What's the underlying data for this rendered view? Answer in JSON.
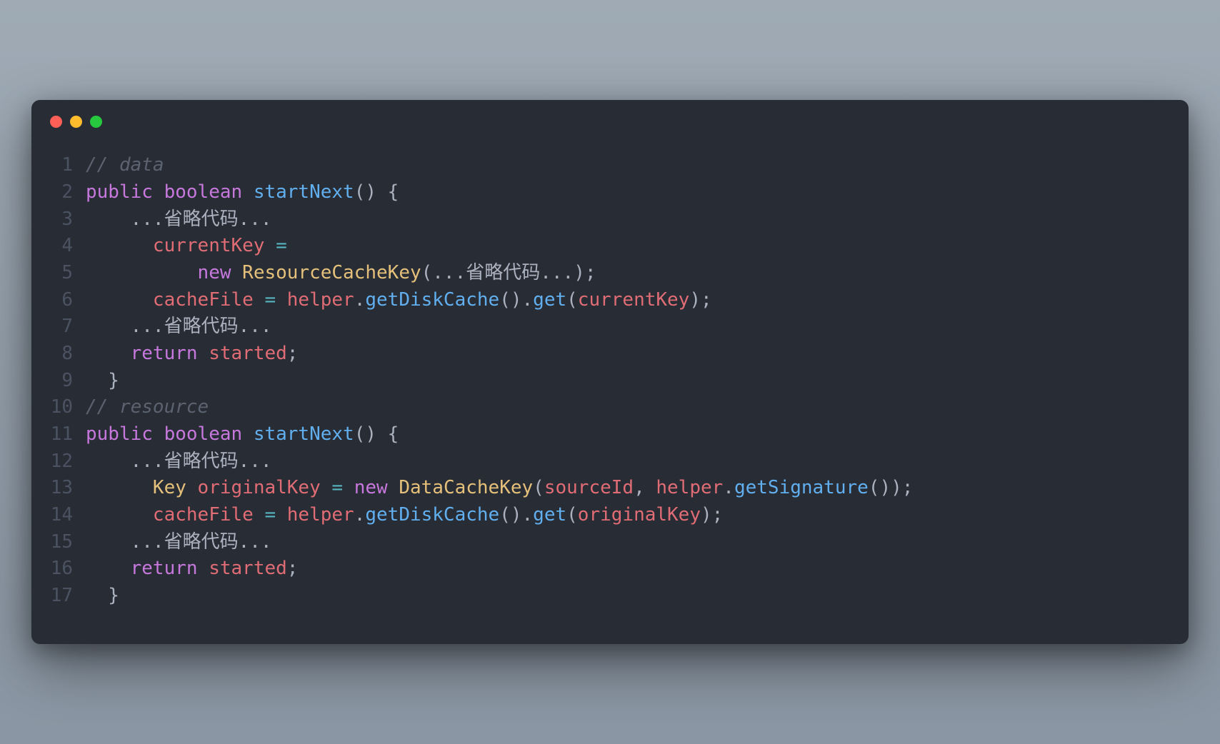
{
  "colors": {
    "bg": "#282c34",
    "gutter": "#4b5363",
    "comment": "#5c6370",
    "keyword": "#c678dd",
    "function": "#61afef",
    "identifier": "#e06c75",
    "class": "#e5c07b",
    "operator": "#56b6c2",
    "text": "#abb2bf",
    "traffic_close": "#ff5f56",
    "traffic_min": "#ffbd2e",
    "traffic_zoom": "#27c93f"
  },
  "lines": [
    {
      "num": "1",
      "tokens": [
        {
          "c": "cm",
          "t": "// data"
        }
      ]
    },
    {
      "num": "2",
      "tokens": [
        {
          "c": "kw",
          "t": "public"
        },
        {
          "c": "tx",
          "t": " "
        },
        {
          "c": "ty",
          "t": "boolean"
        },
        {
          "c": "tx",
          "t": " "
        },
        {
          "c": "fn",
          "t": "startNext"
        },
        {
          "c": "pn",
          "t": "() {"
        }
      ]
    },
    {
      "num": "3",
      "tokens": [
        {
          "c": "tx",
          "t": "    ...省略代码..."
        }
      ]
    },
    {
      "num": "4",
      "tokens": [
        {
          "c": "tx",
          "t": "      "
        },
        {
          "c": "id",
          "t": "currentKey"
        },
        {
          "c": "tx",
          "t": " "
        },
        {
          "c": "op",
          "t": "="
        }
      ]
    },
    {
      "num": "5",
      "tokens": [
        {
          "c": "tx",
          "t": "          "
        },
        {
          "c": "kw",
          "t": "new"
        },
        {
          "c": "tx",
          "t": " "
        },
        {
          "c": "cl",
          "t": "ResourceCacheKey"
        },
        {
          "c": "pn",
          "t": "(...省略代码...);"
        }
      ]
    },
    {
      "num": "6",
      "tokens": [
        {
          "c": "tx",
          "t": "      "
        },
        {
          "c": "id",
          "t": "cacheFile"
        },
        {
          "c": "tx",
          "t": " "
        },
        {
          "c": "op",
          "t": "="
        },
        {
          "c": "tx",
          "t": " "
        },
        {
          "c": "id",
          "t": "helper"
        },
        {
          "c": "pn",
          "t": "."
        },
        {
          "c": "fn",
          "t": "getDiskCache"
        },
        {
          "c": "pn",
          "t": "()."
        },
        {
          "c": "fn",
          "t": "get"
        },
        {
          "c": "pn",
          "t": "("
        },
        {
          "c": "id",
          "t": "currentKey"
        },
        {
          "c": "pn",
          "t": ");"
        }
      ]
    },
    {
      "num": "7",
      "tokens": [
        {
          "c": "tx",
          "t": "    ...省略代码..."
        }
      ]
    },
    {
      "num": "8",
      "tokens": [
        {
          "c": "tx",
          "t": "    "
        },
        {
          "c": "kw",
          "t": "return"
        },
        {
          "c": "tx",
          "t": " "
        },
        {
          "c": "id",
          "t": "started"
        },
        {
          "c": "pn",
          "t": ";"
        }
      ]
    },
    {
      "num": "9",
      "tokens": [
        {
          "c": "pn",
          "t": "  }"
        }
      ]
    },
    {
      "num": "10",
      "tokens": [
        {
          "c": "cm",
          "t": "// resource"
        }
      ]
    },
    {
      "num": "11",
      "tokens": [
        {
          "c": "kw",
          "t": "public"
        },
        {
          "c": "tx",
          "t": " "
        },
        {
          "c": "ty",
          "t": "boolean"
        },
        {
          "c": "tx",
          "t": " "
        },
        {
          "c": "fn",
          "t": "startNext"
        },
        {
          "c": "pn",
          "t": "() {"
        }
      ]
    },
    {
      "num": "12",
      "tokens": [
        {
          "c": "tx",
          "t": "    ...省略代码..."
        }
      ]
    },
    {
      "num": "13",
      "tokens": [
        {
          "c": "tx",
          "t": "      "
        },
        {
          "c": "cl",
          "t": "Key"
        },
        {
          "c": "tx",
          "t": " "
        },
        {
          "c": "id",
          "t": "originalKey"
        },
        {
          "c": "tx",
          "t": " "
        },
        {
          "c": "op",
          "t": "="
        },
        {
          "c": "tx",
          "t": " "
        },
        {
          "c": "kw",
          "t": "new"
        },
        {
          "c": "tx",
          "t": " "
        },
        {
          "c": "cl",
          "t": "DataCacheKey"
        },
        {
          "c": "pn",
          "t": "("
        },
        {
          "c": "id",
          "t": "sourceId"
        },
        {
          "c": "pn",
          "t": ", "
        },
        {
          "c": "id",
          "t": "helper"
        },
        {
          "c": "pn",
          "t": "."
        },
        {
          "c": "fn",
          "t": "getSignature"
        },
        {
          "c": "pn",
          "t": "());"
        }
      ]
    },
    {
      "num": "14",
      "tokens": [
        {
          "c": "tx",
          "t": "      "
        },
        {
          "c": "id",
          "t": "cacheFile"
        },
        {
          "c": "tx",
          "t": " "
        },
        {
          "c": "op",
          "t": "="
        },
        {
          "c": "tx",
          "t": " "
        },
        {
          "c": "id",
          "t": "helper"
        },
        {
          "c": "pn",
          "t": "."
        },
        {
          "c": "fn",
          "t": "getDiskCache"
        },
        {
          "c": "pn",
          "t": "()."
        },
        {
          "c": "fn",
          "t": "get"
        },
        {
          "c": "pn",
          "t": "("
        },
        {
          "c": "id",
          "t": "originalKey"
        },
        {
          "c": "pn",
          "t": ");"
        }
      ]
    },
    {
      "num": "15",
      "tokens": [
        {
          "c": "tx",
          "t": "    ...省略代码..."
        }
      ]
    },
    {
      "num": "16",
      "tokens": [
        {
          "c": "tx",
          "t": "    "
        },
        {
          "c": "kw",
          "t": "return"
        },
        {
          "c": "tx",
          "t": " "
        },
        {
          "c": "id",
          "t": "started"
        },
        {
          "c": "pn",
          "t": ";"
        }
      ]
    },
    {
      "num": "17",
      "tokens": [
        {
          "c": "pn",
          "t": "  }"
        }
      ]
    }
  ]
}
